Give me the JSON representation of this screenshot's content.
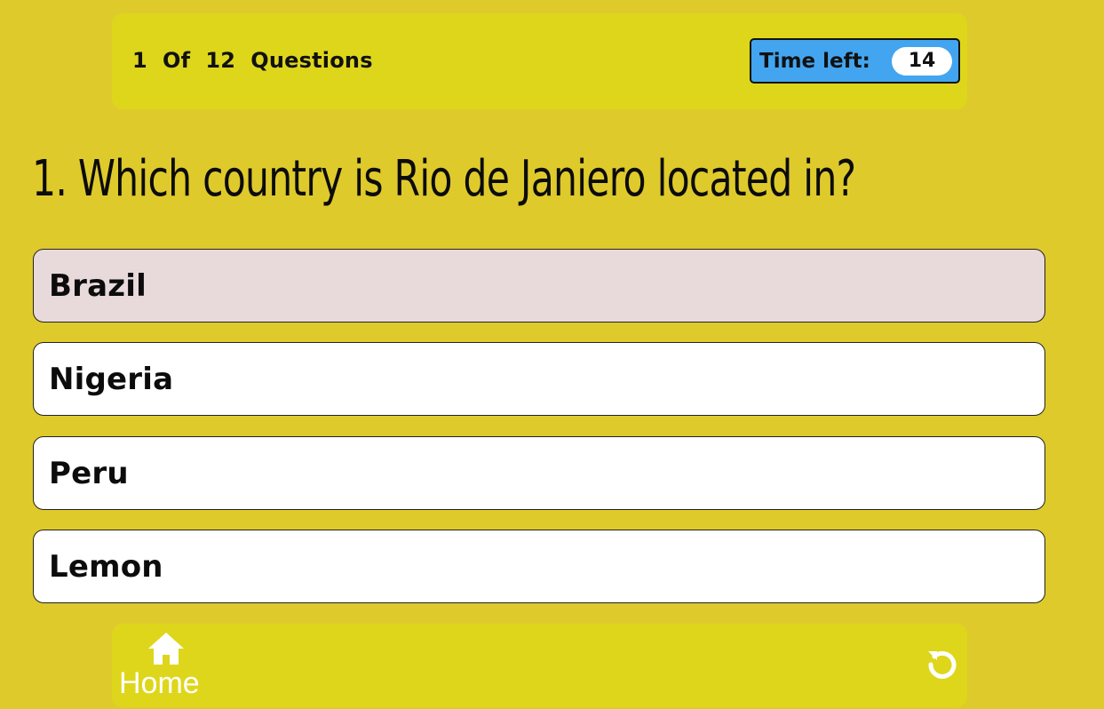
{
  "header": {
    "progress_text": "1  Of  12  Questions",
    "timer_label": "Time left:",
    "timer_value": "14",
    "timer_color": "#43a5ef"
  },
  "question": {
    "text": "1. Which country is Rio de Janiero located in?"
  },
  "choices": [
    {
      "label": "Brazil",
      "selected": true
    },
    {
      "label": "Nigeria",
      "selected": false
    },
    {
      "label": "Peru",
      "selected": false
    },
    {
      "label": "Lemon",
      "selected": false
    }
  ],
  "footer": {
    "home_label": "Home",
    "home_icon": "home-icon",
    "restart_icon": "restart-icon"
  },
  "colors": {
    "background": "#dfca2c",
    "panel": "#ded61b",
    "selected_choice": "#e8d9da"
  }
}
